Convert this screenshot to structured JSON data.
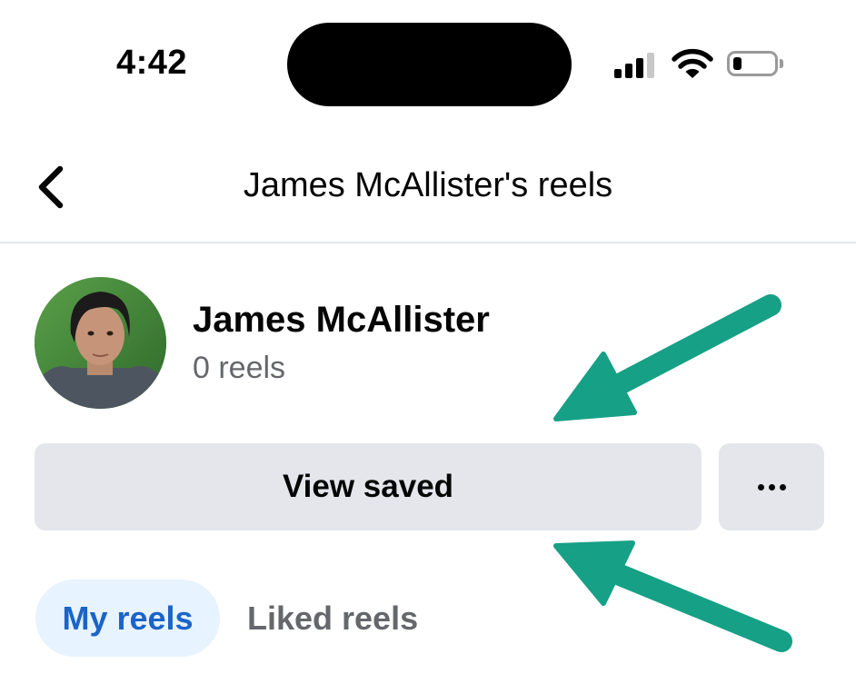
{
  "status_bar": {
    "time": "4:42",
    "icons": [
      "cellular-signal-icon",
      "wifi-icon",
      "battery-icon"
    ]
  },
  "header": {
    "back_icon": "chevron-left-icon",
    "title": "James McAllister's reels"
  },
  "profile": {
    "name": "James McAllister",
    "reel_count": "0 reels"
  },
  "actions": {
    "view_saved_label": "View saved",
    "more_icon": "ellipsis-icon"
  },
  "tabs": [
    {
      "label": "My reels",
      "selected": true
    },
    {
      "label": "Liked reels",
      "selected": false
    }
  ],
  "colors": {
    "button_bg": "#e4e6eb",
    "selected_tab_bg": "#e7f3ff",
    "selected_tab_text": "#1b64c8",
    "secondary_text": "#65676b",
    "annotation_arrow": "#16a085"
  }
}
